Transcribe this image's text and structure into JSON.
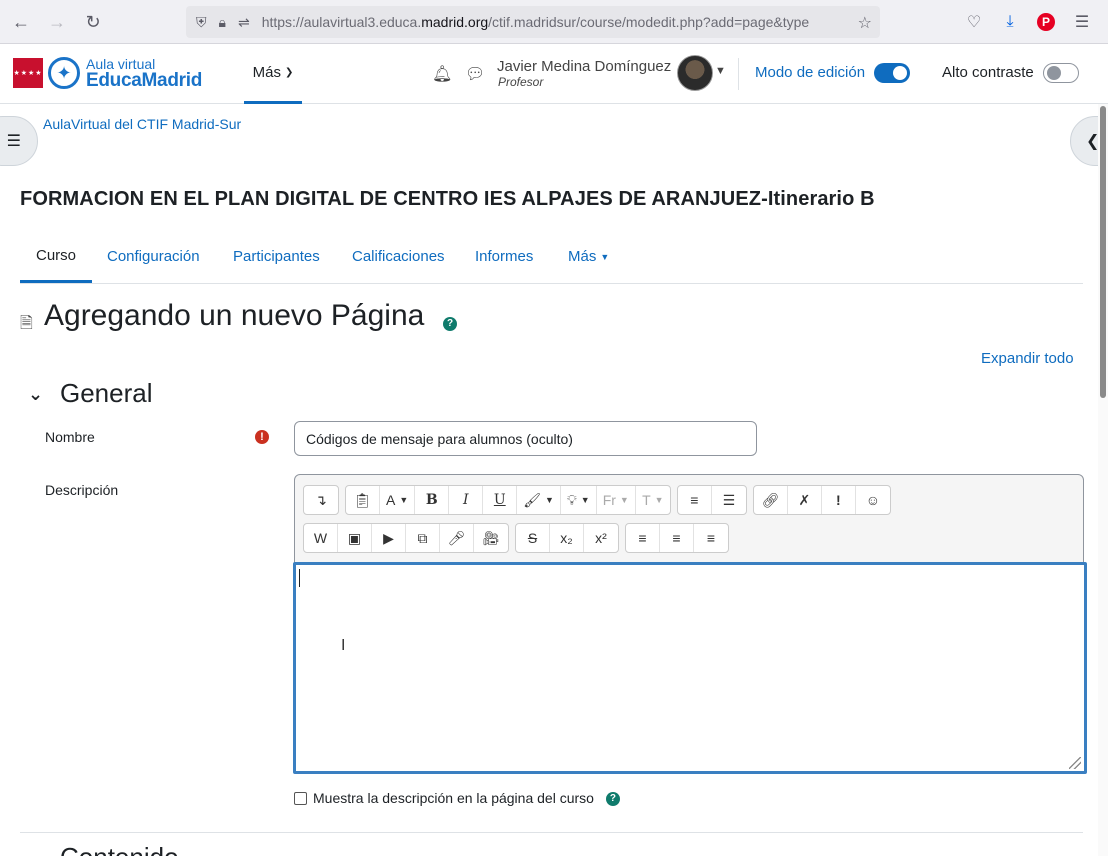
{
  "browser": {
    "url_prefix": "https://aulavirtual3.educa.",
    "url_domain": "madrid.org",
    "url_path": "/ctif.madridsur/course/modedit.php?add=page&type"
  },
  "header": {
    "logo_small": "Aula virtual",
    "logo_big": "EducaMadrid",
    "mas_label": "Más",
    "user_name": "Javier Medina Domínguez",
    "user_role": "Profesor",
    "edit_mode_label": "Modo de edición",
    "edit_mode_on": true,
    "contrast_label": "Alto contraste",
    "contrast_on": false
  },
  "breadcrumb": "AulaVirtual del CTIF Madrid-Sur",
  "course_title": "FORMACION EN EL PLAN DIGITAL DE CENTRO IES ALPAJES DE ARANJUEZ-Itinerario B",
  "course_nav": [
    {
      "label": "Curso",
      "active": true
    },
    {
      "label": "Configuración"
    },
    {
      "label": "Participantes"
    },
    {
      "label": "Calificaciones"
    },
    {
      "label": "Informes"
    },
    {
      "label": "Más"
    }
  ],
  "page_heading": "Agregando un nuevo Página",
  "expand_all": "Expandir todo",
  "section_general": "General",
  "form": {
    "name_label": "Nombre",
    "name_value": "Códigos de mensaje para alumnos (oculto)",
    "description_label": "Descripción",
    "description_value": "",
    "show_description_label": "Muestra la descripción en la página del curso",
    "show_description_checked": false
  },
  "next_section": "Contenido",
  "colors": {
    "link": "#0f6cbf",
    "required": "#ca3120",
    "help": "#0f7b6c",
    "brand_red": "#c8102e"
  }
}
